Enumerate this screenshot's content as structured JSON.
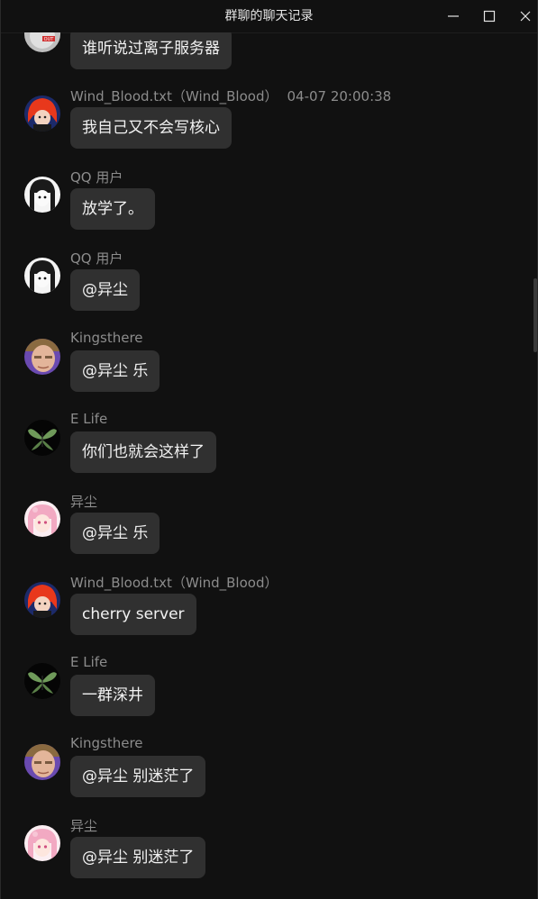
{
  "window": {
    "title": "群聊的聊天记录"
  },
  "icons": {
    "minimize": "minimize-icon",
    "maximize": "maximize-icon",
    "close": "close-icon"
  },
  "messages": [
    {
      "sender": "",
      "time": "",
      "text": "谁听说过离子服务器",
      "avatar": "gray-robot-avatar"
    },
    {
      "sender": "Wind_Blood.txt（Wind_Blood）",
      "time": "04-07 20:00:38",
      "text": "我自己又不会写核心",
      "avatar": "red-hair-anime-avatar"
    },
    {
      "sender": "QQ 用户",
      "time": "",
      "text": "放学了。",
      "avatar": "manga-girl-avatar"
    },
    {
      "sender": "QQ 用户",
      "time": "",
      "text": "@异尘",
      "avatar": "manga-girl-avatar"
    },
    {
      "sender": "Kingsthere",
      "time": "",
      "text": "@异尘 乐",
      "avatar": "man-face-avatar"
    },
    {
      "sender": "E Life",
      "time": "",
      "text": "你们也就会这样了",
      "avatar": "green-moth-avatar"
    },
    {
      "sender": "异尘",
      "time": "",
      "text": "@异尘 乐",
      "avatar": "pink-hair-anime-avatar"
    },
    {
      "sender": "Wind_Blood.txt（Wind_Blood）",
      "time": "",
      "text": "cherry server",
      "avatar": "red-hair-anime-avatar"
    },
    {
      "sender": "E Life",
      "time": "",
      "text": "一群深井",
      "avatar": "green-moth-avatar"
    },
    {
      "sender": "Kingsthere",
      "time": "",
      "text": "@异尘 别迷茫了",
      "avatar": "man-face-avatar"
    },
    {
      "sender": "异尘",
      "time": "",
      "text": "@异尘 别迷茫了",
      "avatar": "pink-hair-anime-avatar"
    }
  ]
}
